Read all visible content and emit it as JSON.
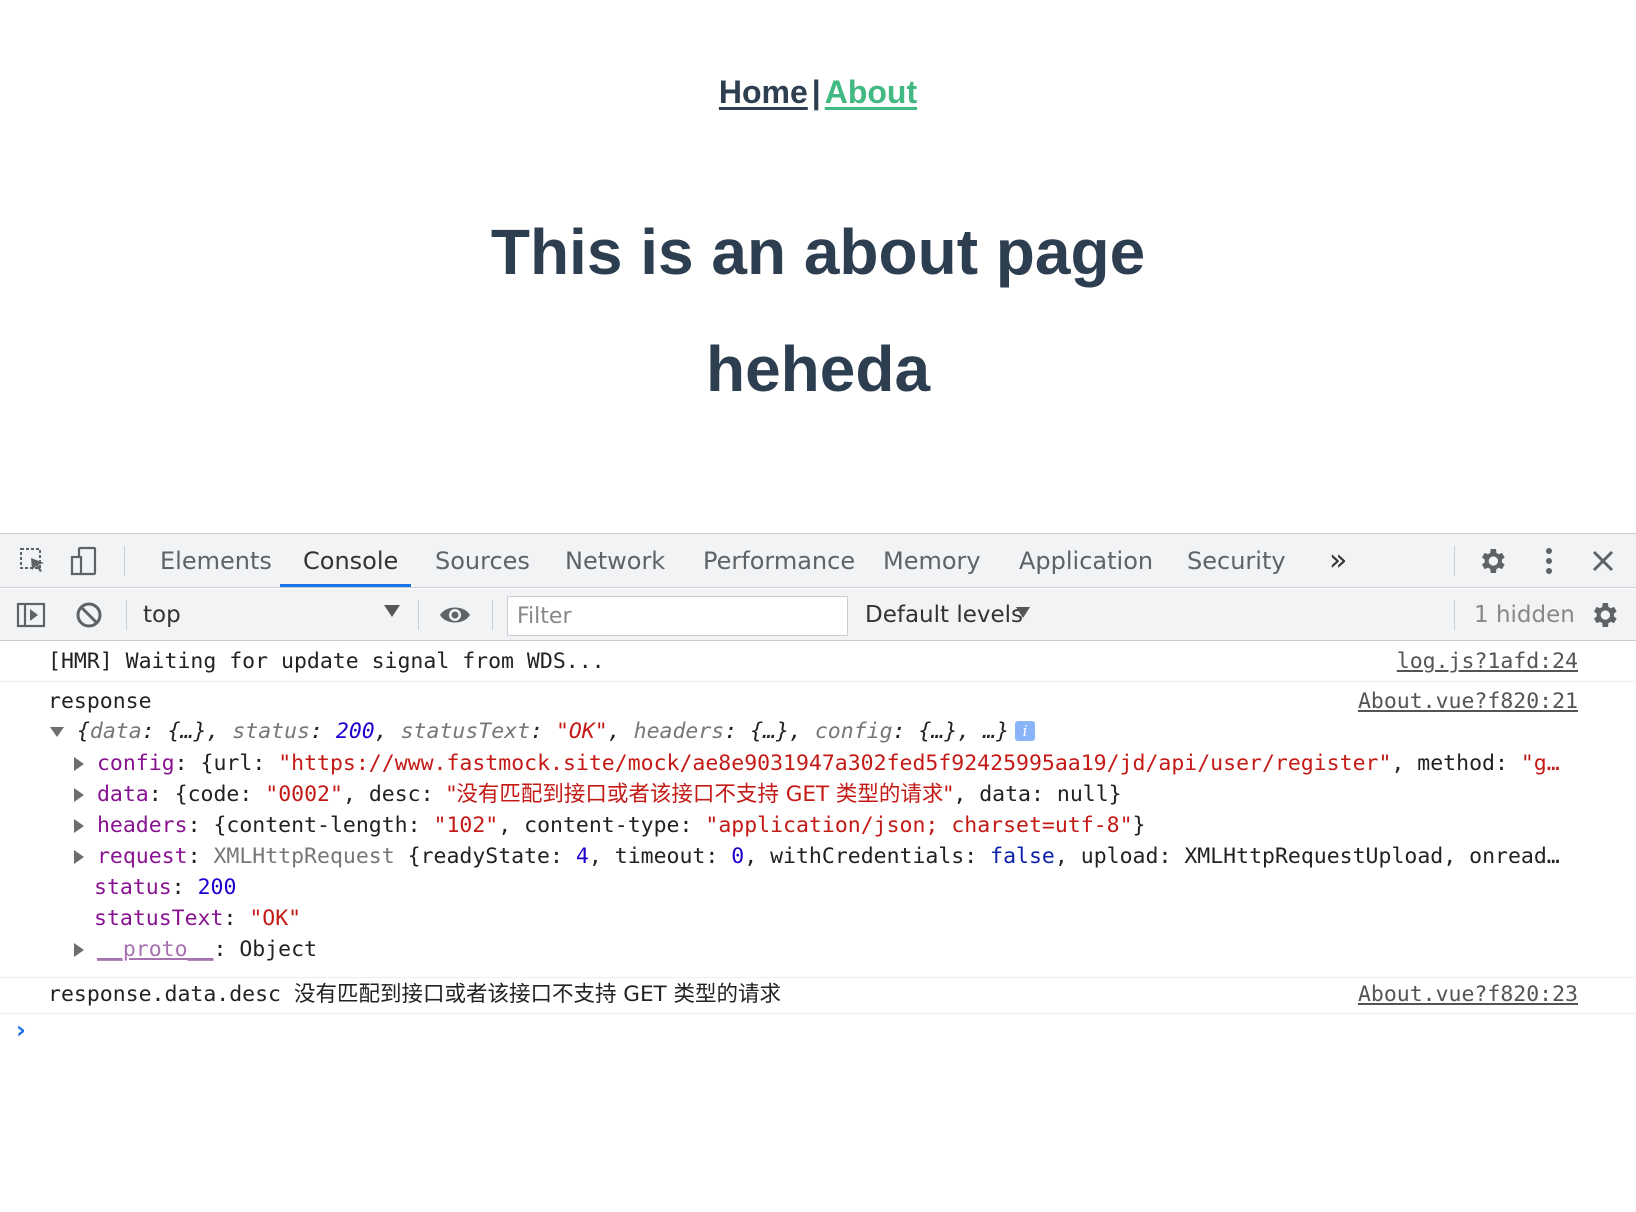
{
  "app": {
    "nav": {
      "home": "Home",
      "separator": "|",
      "about": "About"
    },
    "heading": "This is an about page",
    "subheading": "heheda"
  },
  "devtools": {
    "tabs": [
      "Elements",
      "Console",
      "Sources",
      "Network",
      "Performance",
      "Memory",
      "Application",
      "Security"
    ],
    "selected_tab": "Console",
    "more_tabs": "»",
    "toolbar": {
      "context": "top",
      "filter_placeholder": "Filter",
      "levels": "Default levels",
      "hidden": "1 hidden"
    },
    "colors": {
      "accent": "#1a73e8",
      "link_active": "#42b983",
      "text": "#2c3e50"
    },
    "icons": [
      "inspect-element-icon",
      "device-toolbar-icon",
      "gear-icon",
      "kebab-menu-icon",
      "close-icon",
      "sidebar-toggle-icon",
      "clear-console-icon",
      "eye-icon",
      "settings-gear-icon"
    ]
  },
  "console": {
    "msg1": {
      "text": "[HMR] Waiting for update signal from WDS...",
      "source": "log.js?1afd:24"
    },
    "msg2": {
      "label": "response",
      "source": "About.vue?f820:21",
      "summary": {
        "open": "{",
        "k1": "data",
        "v1": " {…}",
        "k2": "status",
        "v2": "200",
        "k3": "statusText",
        "v3": "\"OK\"",
        "k4": "headers",
        "v4": " {…}",
        "k5": "config",
        "v5": " {…}",
        "tail": ", …}"
      },
      "config": {
        "key": "config",
        "url_key": "url",
        "url": "\"https://www.fastmock.site/mock/ae8e9031947a302fed5f92425995aa19/jd/api/user/register\"",
        "method_key": "method",
        "method": "\"g…"
      },
      "data": {
        "key": "data",
        "code_key": "code",
        "code": "\"0002\"",
        "desc_key": "desc",
        "desc": "\"没有匹配到接口或者该接口不支持 GET 类型的请求\"",
        "data_key": "data",
        "data_val": "null"
      },
      "headers": {
        "key": "headers",
        "len_key": "content-length",
        "len": "\"102\"",
        "type_key": "content-type",
        "type": "\"application/json; charset=utf-8\""
      },
      "request": {
        "key": "request",
        "class": "XMLHttpRequest",
        "rs_key": "readyState",
        "rs": "4",
        "to_key": "timeout",
        "to": "0",
        "wc_key": "withCredentials",
        "wc": "false",
        "up_key": "upload",
        "up": "XMLHttpRequestUpload",
        "tail": "onread…"
      },
      "status": {
        "key": "status",
        "value": "200"
      },
      "statusText": {
        "key": "statusText",
        "value": "\"OK\""
      },
      "proto": {
        "key": "__proto__",
        "value": "Object"
      }
    },
    "msg3": {
      "label": "response.data.desc",
      "value": "没有匹配到接口或者该接口不支持 GET 类型的请求",
      "source": "About.vue?f820:23"
    },
    "prompt": "›"
  }
}
